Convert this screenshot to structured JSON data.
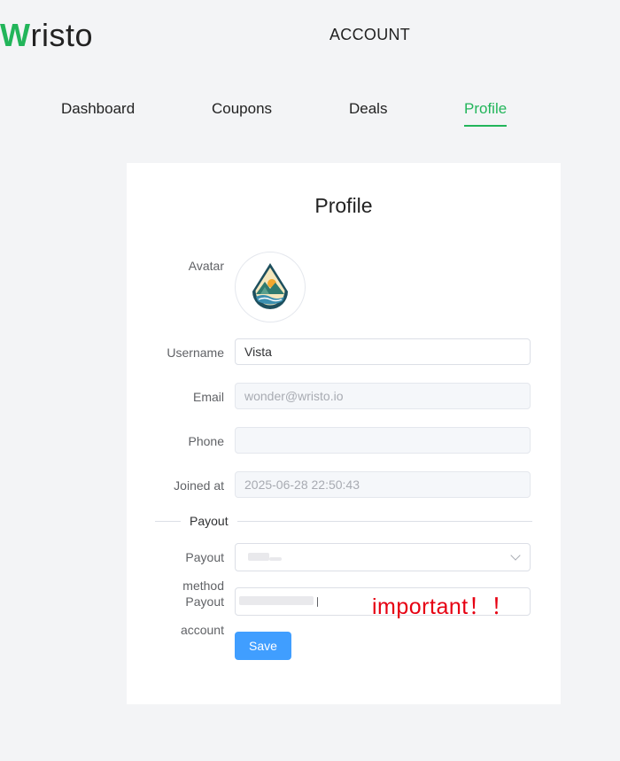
{
  "header": {
    "logo_first": "W",
    "logo_rest": "risto",
    "title": "ACCOUNT"
  },
  "nav": {
    "items": [
      "Dashboard",
      "Coupons",
      "Deals",
      "Profile"
    ],
    "active": "Profile"
  },
  "card": {
    "title": "Profile",
    "avatar_label": "Avatar",
    "username_label": "Username",
    "username_value": "Vista",
    "email_label": "Email",
    "email_value": "wonder@wristo.io",
    "phone_label": "Phone",
    "phone_value": "",
    "joined_label": "Joined at",
    "joined_value": "2025-06-28 22:50:43",
    "payout_section": "Payout",
    "payout_method_label_1": "Payout",
    "payout_method_label_2": "method",
    "payout_account_label_1": "Payout",
    "payout_account_label_2": "account",
    "important_note": "important！！",
    "save_label": "Save"
  },
  "colors": {
    "brand_green": "#22b55a",
    "primary_button": "#409eff",
    "warning_red": "#e60012"
  },
  "icons": {
    "avatar": "mountain-sun-icon",
    "select_arrow": "chevron-down-icon"
  }
}
